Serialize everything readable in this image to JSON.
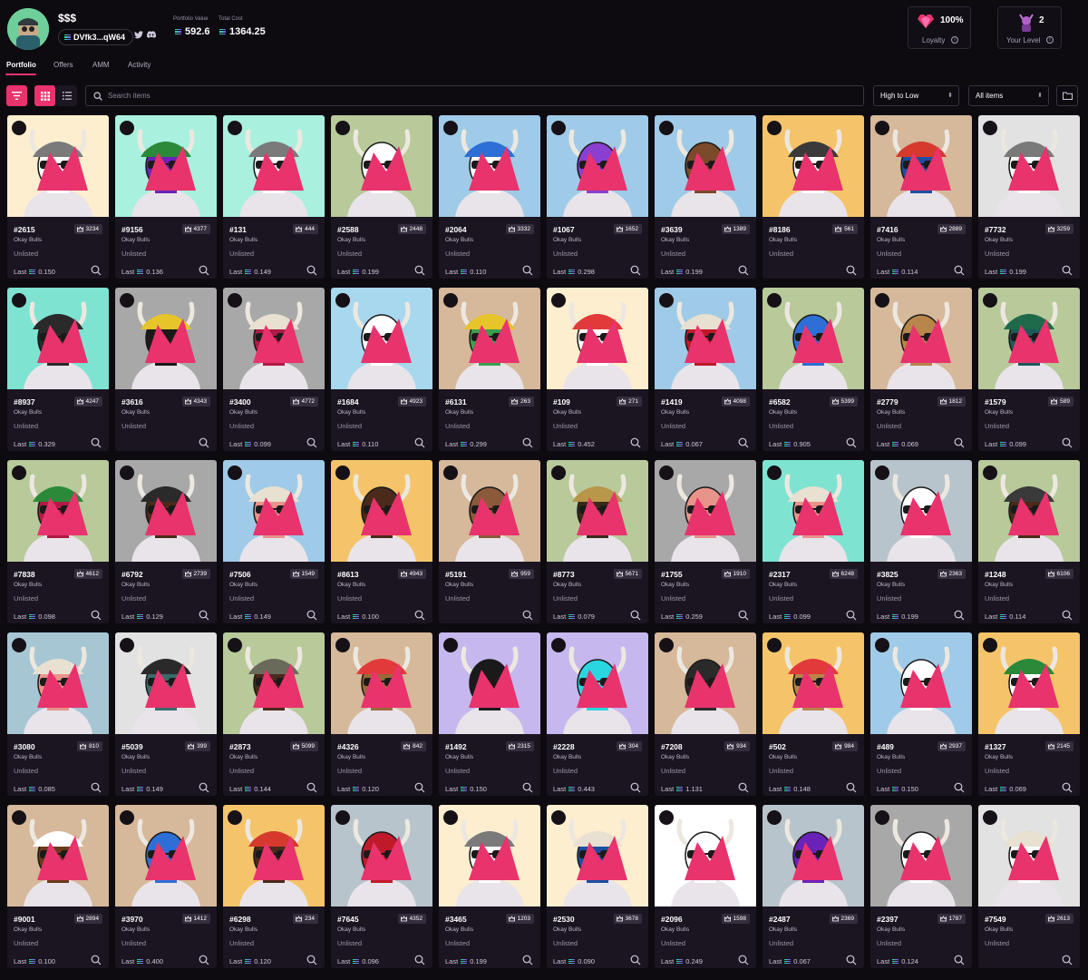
{
  "profile": {
    "name": "$$$",
    "wallet": "DVfk3...qW64",
    "portfolio_label": "Portfolio Value",
    "portfolio_value": "592.6",
    "cost_label": "Total Cost",
    "cost_value": "1364.25",
    "loyalty_value": "100%",
    "loyalty_label": "Loyalty",
    "level_value": "2",
    "level_label": "Your Level"
  },
  "tabs": [
    {
      "label": "Portfolio",
      "active": true
    },
    {
      "label": "Offers",
      "active": false
    },
    {
      "label": "AMM",
      "active": false
    },
    {
      "label": "Activity",
      "active": false
    }
  ],
  "toolbar": {
    "search_placeholder": "Search items",
    "sort_label": "High to Low",
    "filter_label": "All items"
  },
  "collection_name": "Okay Bulls",
  "status_text": "Unlisted",
  "last_prefix": "Last",
  "cards": [
    {
      "id": "#2615",
      "rank": "3234",
      "last": "0.150",
      "bg": "#fdeecf",
      "skin": "#ffffff",
      "hat": "#7a7a7a"
    },
    {
      "id": "#9156",
      "rank": "4377",
      "last": "0.136",
      "bg": "#a9f0df",
      "skin": "#6b22b8",
      "hat": "#2a8a3a"
    },
    {
      "id": "#131",
      "rank": "444",
      "last": "0.149",
      "bg": "#a9f0df",
      "skin": "#ffffff",
      "hat": "#7a7a7a"
    },
    {
      "id": "#2588",
      "rank": "2448",
      "last": "0.199",
      "bg": "#b8c99a",
      "skin": "#ffffff",
      "hat": ""
    },
    {
      "id": "#2064",
      "rank": "3332",
      "last": "0.110",
      "bg": "#9fcbe8",
      "skin": "#ffffff",
      "hat": "#2d6fd6"
    },
    {
      "id": "#1067",
      "rank": "1652",
      "last": "0.298",
      "bg": "#9fcbe8",
      "skin": "#8a3fd0",
      "hat": ""
    },
    {
      "id": "#3639",
      "rank": "1389",
      "last": "0.199",
      "bg": "#9fcbe8",
      "skin": "#7a4a2a",
      "hat": ""
    },
    {
      "id": "#8186",
      "rank": "561",
      "last": "",
      "bg": "#f5c46a",
      "skin": "#ffffff",
      "hat": "#3a3a3a"
    },
    {
      "id": "#7416",
      "rank": "2889",
      "last": "0.114",
      "bg": "#d6b89a",
      "skin": "#1d4fa0",
      "hat": "#d63a2d"
    },
    {
      "id": "#7732",
      "rank": "3259",
      "last": "0.199",
      "bg": "#e2e2e2",
      "skin": "#ffffff",
      "hat": "#7a7a7a"
    },
    {
      "id": "#8937",
      "rank": "4247",
      "last": "0.329",
      "bg": "#7fe3d2",
      "skin": "#2a2a2a",
      "hat": "#2a2a2a"
    },
    {
      "id": "#3616",
      "rank": "4343",
      "last": "",
      "bg": "#a8a8a8",
      "skin": "#1a1a1a",
      "hat": "#e6c42a"
    },
    {
      "id": "#3400",
      "rank": "4772",
      "last": "0.099",
      "bg": "#a8a8a8",
      "skin": "#b01a45",
      "hat": "#e8e0d0"
    },
    {
      "id": "#1684",
      "rank": "4923",
      "last": "0.110",
      "bg": "#a7d8ee",
      "skin": "#ffffff",
      "hat": ""
    },
    {
      "id": "#6131",
      "rank": "263",
      "last": "0.299",
      "bg": "#d6b89a",
      "skin": "#3aa050",
      "hat": "#e6c42a"
    },
    {
      "id": "#109",
      "rank": "271",
      "last": "0.452",
      "bg": "#fdeecf",
      "skin": "#ffffff",
      "hat": "#e23a3a"
    },
    {
      "id": "#1419",
      "rank": "4098",
      "last": "0.067",
      "bg": "#9fcbe8",
      "skin": "#c01a2a",
      "hat": "#e8e0d0"
    },
    {
      "id": "#6582",
      "rank": "5399",
      "last": "0.905",
      "bg": "#b8c99a",
      "skin": "#2d6fd6",
      "hat": ""
    },
    {
      "id": "#2779",
      "rank": "1812",
      "last": "0.069",
      "bg": "#d6b89a",
      "skin": "#b8864a",
      "hat": ""
    },
    {
      "id": "#1579",
      "rank": "589",
      "last": "0.099",
      "bg": "#b8c99a",
      "skin": "#1e5a5a",
      "hat": "#1e6a4a"
    },
    {
      "id": "#7838",
      "rank": "4612",
      "last": "0.098",
      "bg": "#b8c99a",
      "skin": "#b01a45",
      "hat": "#2a8a3a"
    },
    {
      "id": "#6792",
      "rank": "2739",
      "last": "0.129",
      "bg": "#a8a8a8",
      "skin": "#4a2a1a",
      "hat": "#2a2a2a"
    },
    {
      "id": "#7506",
      "rank": "1549",
      "last": "0.149",
      "bg": "#9fcbe8",
      "skin": "#e8948a",
      "hat": "#e8e0d0"
    },
    {
      "id": "#8613",
      "rank": "4943",
      "last": "0.100",
      "bg": "#f5c46a",
      "skin": "#4a2a1a",
      "hat": ""
    },
    {
      "id": "#5191",
      "rank": "959",
      "last": "",
      "bg": "#d6b89a",
      "skin": "#8a5a3a",
      "hat": ""
    },
    {
      "id": "#8773",
      "rank": "5671",
      "last": "0.079",
      "bg": "#b8c99a",
      "skin": "#3a2a1a",
      "hat": "#b8964a"
    },
    {
      "id": "#1755",
      "rank": "1910",
      "last": "0.259",
      "bg": "#a8a8a8",
      "skin": "#e8948a",
      "hat": ""
    },
    {
      "id": "#2317",
      "rank": "6248",
      "last": "0.099",
      "bg": "#7fe3d2",
      "skin": "#e8948a",
      "hat": "#e8e0d0"
    },
    {
      "id": "#3825",
      "rank": "2363",
      "last": "0.199",
      "bg": "#b8c4cc",
      "skin": "#ffffff",
      "hat": ""
    },
    {
      "id": "#1248",
      "rank": "6106",
      "last": "0.114",
      "bg": "#b8c99a",
      "skin": "#4a2a1a",
      "hat": "#3a3a3a"
    },
    {
      "id": "#3080",
      "rank": "810",
      "last": "0.085",
      "bg": "#a7c6d4",
      "skin": "#e8948a",
      "hat": "#e8e0d0"
    },
    {
      "id": "#5039",
      "rank": "399",
      "last": "0.149",
      "bg": "#e2e2e2",
      "skin": "#3a6a6a",
      "hat": "#2a2a2a"
    },
    {
      "id": "#2873",
      "rank": "5099",
      "last": "0.144",
      "bg": "#b8c99a",
      "skin": "#4a2a1a",
      "hat": "#6a6a5a"
    },
    {
      "id": "#4326",
      "rank": "842",
      "last": "0.120",
      "bg": "#d6b89a",
      "skin": "#9a6a3a",
      "hat": "#e23a3a"
    },
    {
      "id": "#1492",
      "rank": "2315",
      "last": "0.150",
      "bg": "#c6b8ee",
      "skin": "#1a1a1a",
      "hat": ""
    },
    {
      "id": "#2228",
      "rank": "304",
      "last": "0.443",
      "bg": "#c6b8ee",
      "skin": "#2ad6e0",
      "hat": ""
    },
    {
      "id": "#7208",
      "rank": "934",
      "last": "1.131",
      "bg": "#d6b89a",
      "skin": "#2a2a2a",
      "hat": ""
    },
    {
      "id": "#502",
      "rank": "984",
      "last": "0.148",
      "bg": "#f5c46a",
      "skin": "#b8864a",
      "hat": "#e23a3a"
    },
    {
      "id": "#489",
      "rank": "2937",
      "last": "0.150",
      "bg": "#9fcbe8",
      "skin": "#ffffff",
      "hat": ""
    },
    {
      "id": "#1327",
      "rank": "2145",
      "last": "0.069",
      "bg": "#f5c46a",
      "skin": "#ffffff",
      "hat": "#2a8a3a"
    },
    {
      "id": "#9001",
      "rank": "2894",
      "last": "0.100",
      "bg": "#d6b89a",
      "skin": "#6a3a1a",
      "hat": "#ffffff"
    },
    {
      "id": "#3970",
      "rank": "1412",
      "last": "0.400",
      "bg": "#d6b89a",
      "skin": "#2d6fd6",
      "hat": ""
    },
    {
      "id": "#6298",
      "rank": "234",
      "last": "0.120",
      "bg": "#f5c46a",
      "skin": "#4a2a1a",
      "hat": "#d63a2d"
    },
    {
      "id": "#7645",
      "rank": "4352",
      "last": "0.096",
      "bg": "#b8c4cc",
      "skin": "#c01a2a",
      "hat": ""
    },
    {
      "id": "#3465",
      "rank": "1203",
      "last": "0.199",
      "bg": "#fdeecf",
      "skin": "#ffffff",
      "hat": "#7a7a7a"
    },
    {
      "id": "#2530",
      "rank": "3678",
      "last": "0.090",
      "bg": "#fdeecf",
      "skin": "#1d4fa0",
      "hat": "#e8e0d0"
    },
    {
      "id": "#2096",
      "rank": "1598",
      "last": "0.249",
      "bg": "#ffffff",
      "skin": "#ffffff",
      "hat": ""
    },
    {
      "id": "#2487",
      "rank": "2369",
      "last": "0.067",
      "bg": "#b8c4cc",
      "skin": "#6b22b8",
      "hat": ""
    },
    {
      "id": "#2397",
      "rank": "1787",
      "last": "0.124",
      "bg": "#a8a8a8",
      "skin": "#ffffff",
      "hat": ""
    },
    {
      "id": "#7549",
      "rank": "2613",
      "last": "",
      "bg": "#e2e2e2",
      "skin": "#ffffff",
      "hat": "#e8e0d0"
    }
  ],
  "colors": {
    "accent": "#e8336d",
    "background": "#0d0a10",
    "card": "#1a1520"
  }
}
